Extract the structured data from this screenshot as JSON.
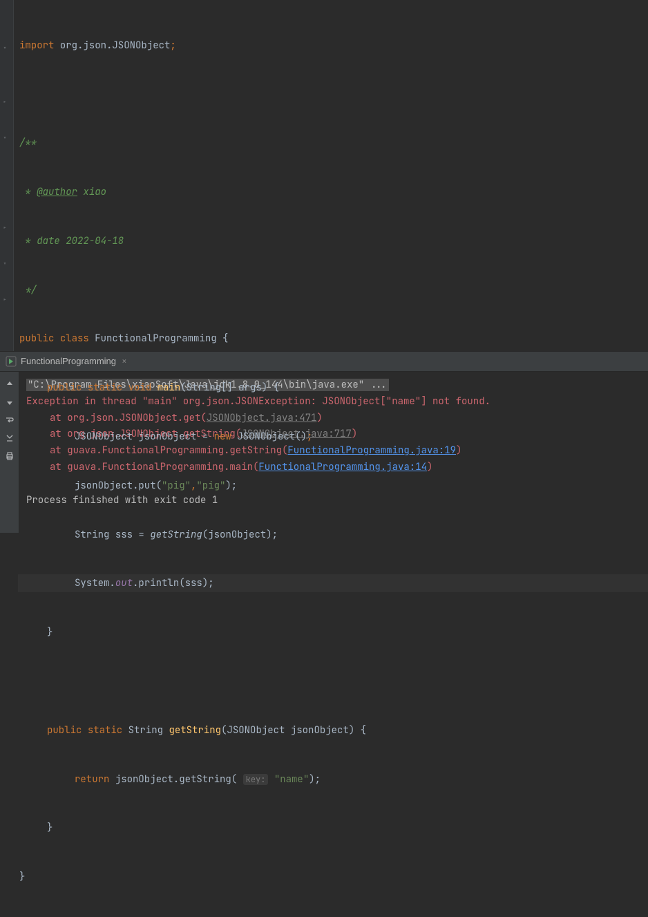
{
  "code": {
    "import_kw": "import",
    "import_pkg": " org.json.JSONObject",
    "semicolon": ";",
    "doc_open": "/**",
    "doc_author_prefix": " * ",
    "doc_author_tag": "@author",
    "doc_author_name": " xiao",
    "doc_date": " * date 2022-04-18",
    "doc_close": " */",
    "public_kw": "public ",
    "class_kw": "class ",
    "class_name": "FunctionalProgramming ",
    "brace_open": "{",
    "brace_close": "}",
    "static_kw": "static ",
    "void_kw": "void ",
    "main_name": "main",
    "main_params_open": "(",
    "main_params_type": "String[] args",
    "main_params_close": ") ",
    "json_type": "JSONObject ",
    "json_var": "jsonObject ",
    "eq": "= ",
    "new_kw": "new ",
    "ctor": "JSONObject",
    "empty_parens": "()",
    "put_call_obj": "jsonObject.put(",
    "str_pig1": "\"pig\"",
    "comma": ",",
    "str_pig2": "\"pig\"",
    "close_paren_semi": ");",
    "string_type": "String ",
    "sss_var": "sss ",
    "getString_call": "getString",
    "open_paren": "(",
    "json_arg": "jsonObject",
    "system": "System.",
    "out": "out",
    "println": ".println(",
    "sss_arg": "sss",
    "string_ret": "String ",
    "getString_decl": "getString",
    "gs_params": "JSONObject jsonObject",
    "return_kw": "return ",
    "gs_body": "jsonObject.getString( ",
    "key_hint": "key:",
    "name_str": " \"name\"",
    "just_close_semi": ");"
  },
  "run": {
    "tab_label": "FunctionalProgramming",
    "cmd_line": "\"C:\\Program Files\\xiaoSoft\\Java\\jdk1.8.0_144\\bin\\java.exe\" ...",
    "exception": "Exception in thread \"main\" org.json.JSONException: JSONObject[\"name\"] not found.",
    "trace1_prefix": "at org.json.JSONObject.get(",
    "trace1_link": "JSONObject.java:471",
    "trace1_suffix": ")",
    "trace2_prefix": "at org.json.JSONObject.getString(",
    "trace2_link": "JSONObject.java:717",
    "trace2_suffix": ")",
    "trace3_prefix": "at guava.FunctionalProgramming.getString(",
    "trace3_link": "FunctionalProgramming.java:19",
    "trace3_suffix": ")",
    "trace4_prefix": "at guava.FunctionalProgramming.main(",
    "trace4_link": "FunctionalProgramming.java:14",
    "trace4_suffix": ")",
    "exit": "Process finished with exit code 1"
  }
}
